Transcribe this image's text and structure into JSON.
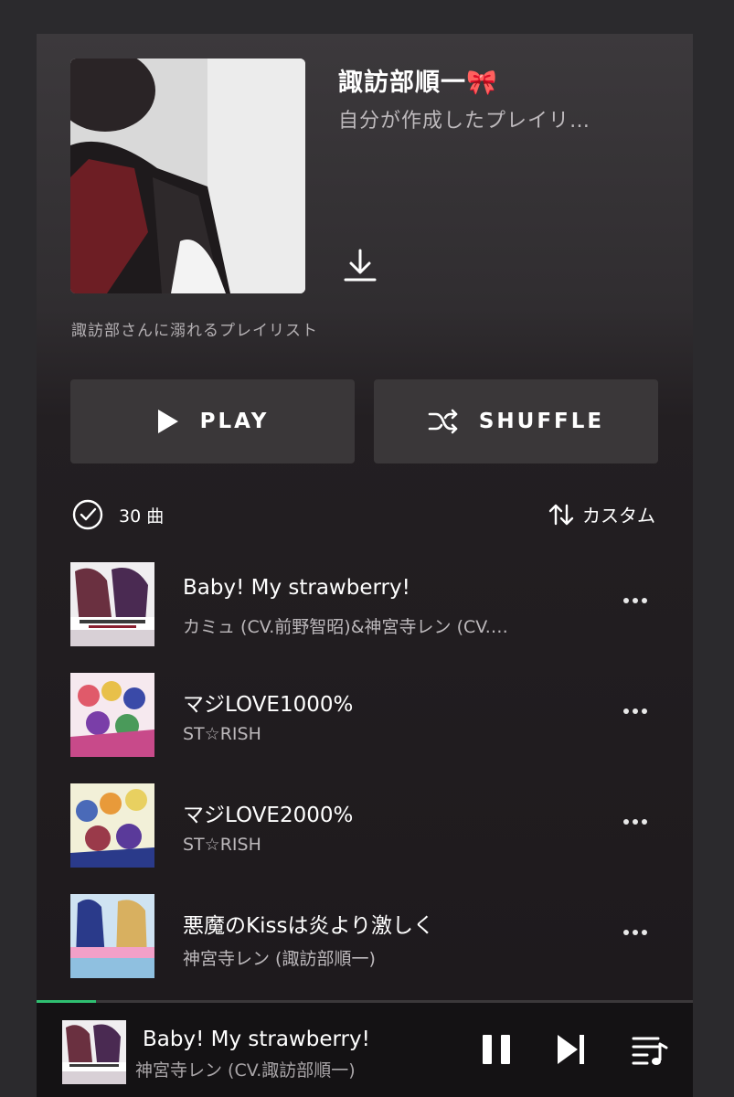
{
  "playlist": {
    "title": "諏訪部順一🎀",
    "subtitle": "自分が作成したプレイリ…",
    "description": "諏訪部さんに溺れるプレイリスト"
  },
  "actions": {
    "play_label": "PLAY",
    "shuffle_label": "SHUFFLE"
  },
  "summary": {
    "count_label": "30 曲",
    "sort_label": "カスタム"
  },
  "tracks": [
    {
      "title": "Baby! My strawberry!",
      "artist": "カミュ (CV.前野智昭)&神宮寺レン (CV.…"
    },
    {
      "title": "マジLOVE1000%",
      "artist": "ST☆RISH"
    },
    {
      "title": "マジLOVE2000%",
      "artist": "ST☆RISH"
    },
    {
      "title": "悪魔のKissは炎より激しく",
      "artist": "神宮寺レン (諏訪部順一)"
    }
  ],
  "now_playing": {
    "title": "Baby! My strawberry!",
    "artist": "神宮寺レン (CV.諏訪部順一)",
    "progress": 0.09
  },
  "icons": {
    "download": "download-icon",
    "play": "play-icon",
    "shuffle": "shuffle-icon",
    "check": "check-circle-icon",
    "sort": "sort-arrows-icon",
    "more": "more-icon",
    "pause": "pause-icon",
    "next": "next-icon",
    "queue": "queue-icon"
  },
  "colors": {
    "accent": "#2fbf71",
    "background": "#1d191c",
    "button": "#3a3739"
  }
}
